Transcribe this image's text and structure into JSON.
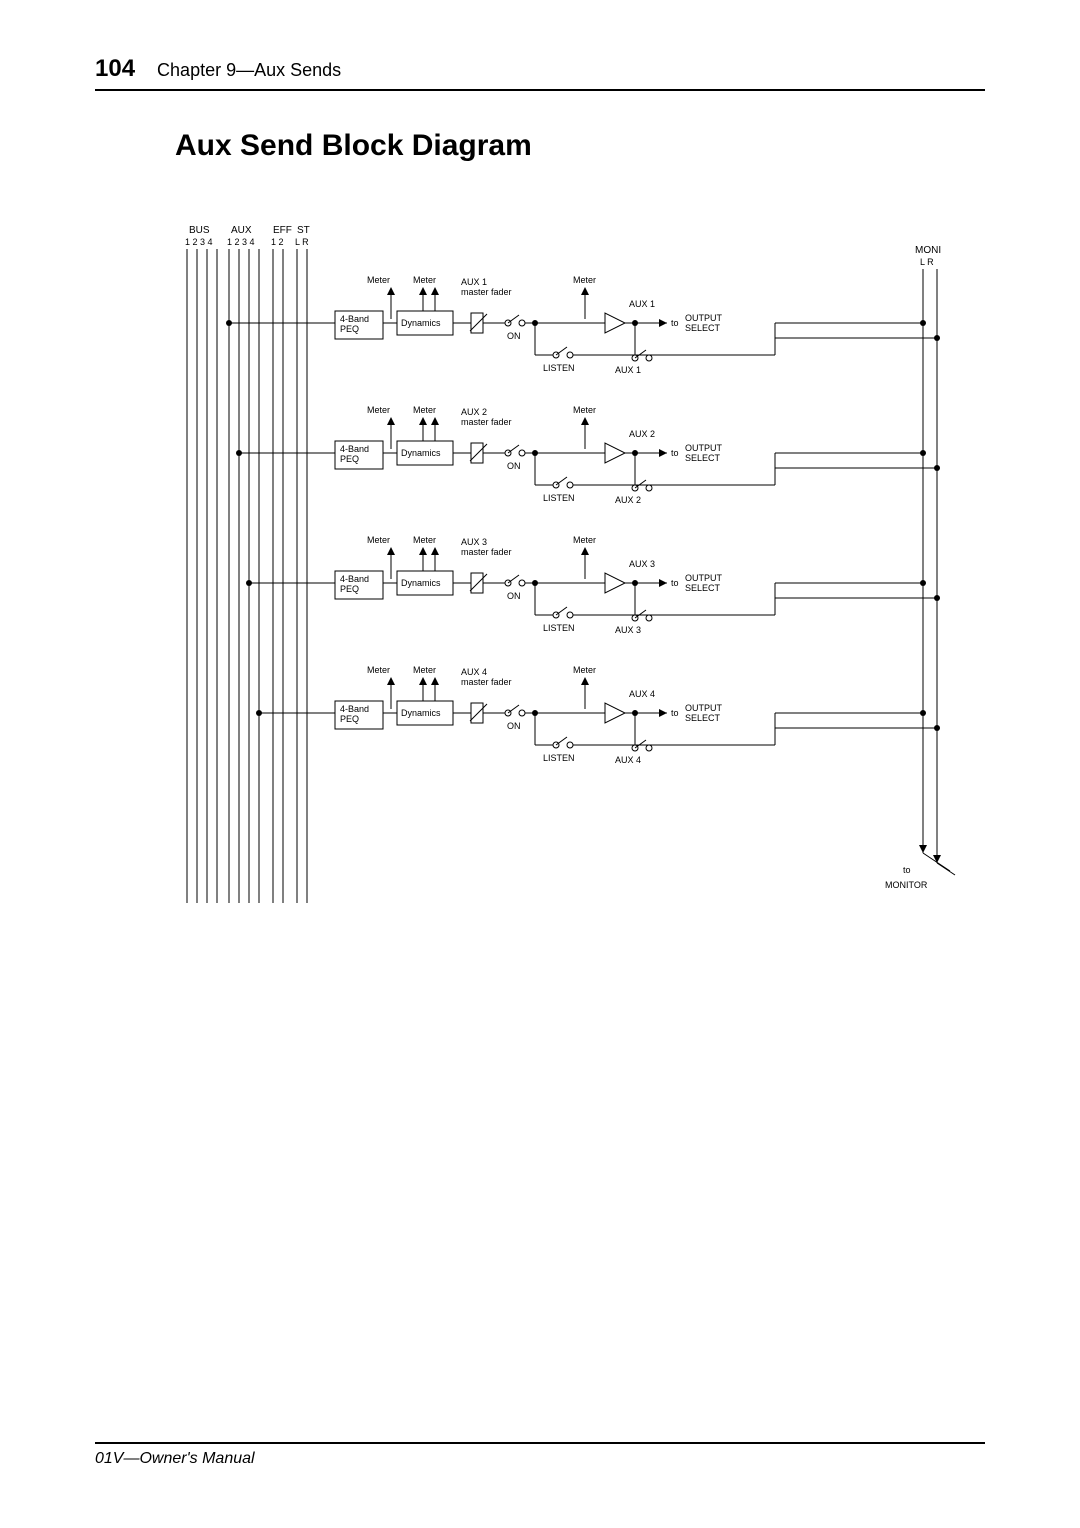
{
  "page_number": "104",
  "chapter_title": "Chapter 9—Aux Sends",
  "section_title": "Aux Send Block Diagram",
  "footer": "01V—Owner's Manual",
  "bus_headers": {
    "bus": "BUS",
    "aux": "AUX",
    "eff": "EFF",
    "st": "ST",
    "bus_nums": "1 2 3 4",
    "aux_nums": "1 2 3 4",
    "eff_nums": "1 2",
    "st_nums": "L R"
  },
  "moni": {
    "label": "MONI",
    "lr": "L R"
  },
  "channels": [
    {
      "meter1": "Meter",
      "meter2": "Meter",
      "meter3": "Meter",
      "peq": "4-Band\nPEQ",
      "dyn": "Dynamics",
      "fader": "AUX 1\nmaster fader",
      "on": "ON",
      "listen": "LISTEN",
      "out_top": "AUX 1",
      "out_bot": "AUX 1",
      "to": "to",
      "select": "OUTPUT\nSELECT"
    },
    {
      "meter1": "Meter",
      "meter2": "Meter",
      "meter3": "Meter",
      "peq": "4-Band\nPEQ",
      "dyn": "Dynamics",
      "fader": "AUX 2\nmaster fader",
      "on": "ON",
      "listen": "LISTEN",
      "out_top": "AUX 2",
      "out_bot": "AUX 2",
      "to": "to",
      "select": "OUTPUT\nSELECT"
    },
    {
      "meter1": "Meter",
      "meter2": "Meter",
      "meter3": "Meter",
      "peq": "4-Band\nPEQ",
      "dyn": "Dynamics",
      "fader": "AUX 3\nmaster fader",
      "on": "ON",
      "listen": "LISTEN",
      "out_top": "AUX 3",
      "out_bot": "AUX 3",
      "to": "to",
      "select": "OUTPUT\nSELECT"
    },
    {
      "meter1": "Meter",
      "meter2": "Meter",
      "meter3": "Meter",
      "peq": "4-Band\nPEQ",
      "dyn": "Dynamics",
      "fader": "AUX 4\nmaster fader",
      "on": "ON",
      "listen": "LISTEN",
      "out_top": "AUX 4",
      "out_bot": "AUX 4",
      "to": "to",
      "select": "OUTPUT\nSELECT"
    }
  ],
  "monitor": {
    "to": "to",
    "label": "MONITOR"
  }
}
